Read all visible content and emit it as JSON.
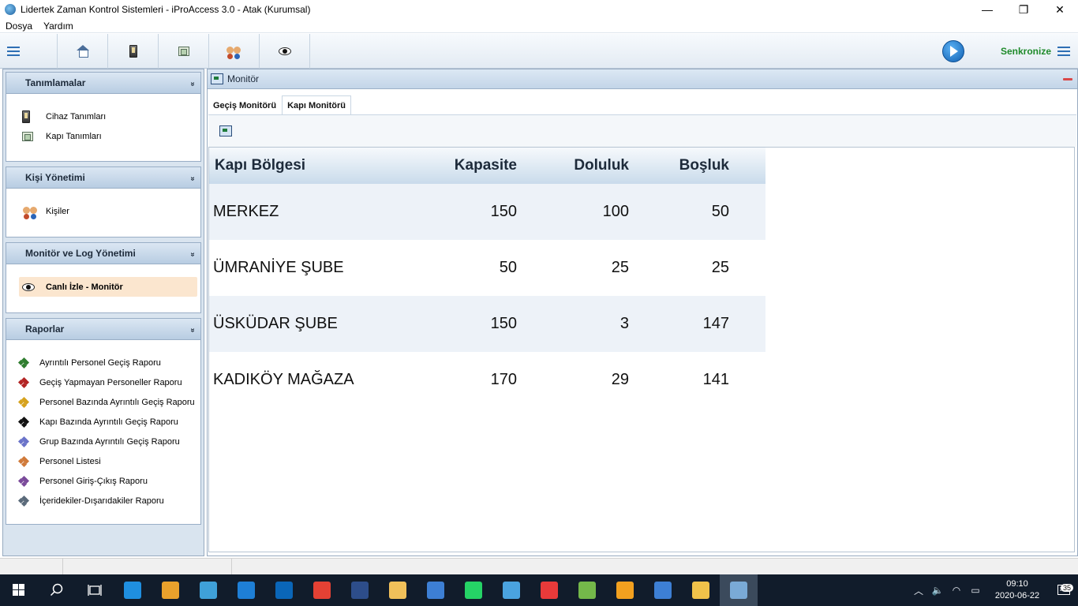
{
  "window": {
    "title": "Lidertek Zaman Kontrol Sistemleri - iProAccess 3.0 - Atak  (Kurumsal)",
    "minimize": "—",
    "maximize": "❐",
    "close": "✕"
  },
  "menu": {
    "items": [
      "Dosya",
      "Yardım"
    ]
  },
  "toolbar": {
    "sync_label": "Senkronize",
    "icons": [
      "menu-icon",
      "home-icon",
      "device-icon",
      "door-icon",
      "users-icon",
      "eye-icon",
      "play-icon",
      "menu-icon"
    ]
  },
  "sidebar": {
    "panels": [
      {
        "title": "Tanımlamalar",
        "items": [
          "Cihaz Tanımları",
          "Kapı Tanımları"
        ]
      },
      {
        "title": "Kişi Yönetimi",
        "items": [
          "Kişiler"
        ]
      },
      {
        "title": "Monitör ve Log Yönetimi",
        "items": [
          "Canlı İzle  -  Monitör"
        ]
      },
      {
        "title": "Raporlar",
        "items": [
          "Ayrıntılı Personel Geçiş Raporu",
          "Geçiş Yapmayan Personeller Raporu",
          "Personel Bazında Ayrıntılı Geçiş Raporu",
          "Kapı Bazında Ayrıntılı Geçiş Raporu",
          "Grup Bazında Ayrıntılı Geçiş Raporu",
          "Personel Listesi",
          "Personel Giriş-Çıkış Raporu",
          "İçeridekiler-Dışarıdakiler Raporu"
        ]
      }
    ],
    "report_colors": [
      "#2f7d2f",
      "#b32424",
      "#d6a21d",
      "#111111",
      "#6a73c9",
      "#d07a3a",
      "#7a4a9a",
      "#5a6a7a"
    ]
  },
  "main": {
    "title": "Monitör",
    "tabs": [
      {
        "label": "Geçiş Monitörü",
        "active": false
      },
      {
        "label": "Kapı Monitörü",
        "active": true
      }
    ],
    "table": {
      "headers": [
        "Kapı Bölgesi",
        "Kapasite",
        "Doluluk",
        "Boşluk"
      ],
      "rows": [
        [
          "MERKEZ",
          "150",
          "100",
          "50"
        ],
        [
          "ÜMRANİYE ŞUBE",
          "50",
          "25",
          "25"
        ],
        [
          "ÜSKÜDAR ŞUBE",
          "150",
          "3",
          "147"
        ],
        [
          "KADIKÖY MAĞAZA",
          "170",
          "29",
          "141"
        ]
      ]
    }
  },
  "taskbar": {
    "clock_time": "09:10",
    "clock_date": "2020-06-22",
    "notification_count": "35",
    "apps": [
      "edge-icon",
      "store-icon",
      "maps-icon",
      "ie-icon",
      "outlook-icon",
      "chrome-icon",
      "photoshop-icon",
      "paint-icon",
      "xamarin-icon",
      "whatsapp-icon",
      "calculator-icon",
      "anydesk-icon",
      "teamviewer-icon",
      "notes-icon",
      "xamarin-icon",
      "explorer-icon",
      "iproaccess-icon"
    ],
    "app_colors": [
      "#1f8fe0",
      "#e9a12c",
      "#3fa0d8",
      "#1e7fd6",
      "#0a66b8",
      "#e44134",
      "#2d4d8a",
      "#f0c05a",
      "#3d7fd4",
      "#25d366",
      "#4aa3df",
      "#e83a3a",
      "#74b84a",
      "#f2a01f",
      "#3d7fd4",
      "#f0c24a",
      "#7aaad6"
    ]
  }
}
